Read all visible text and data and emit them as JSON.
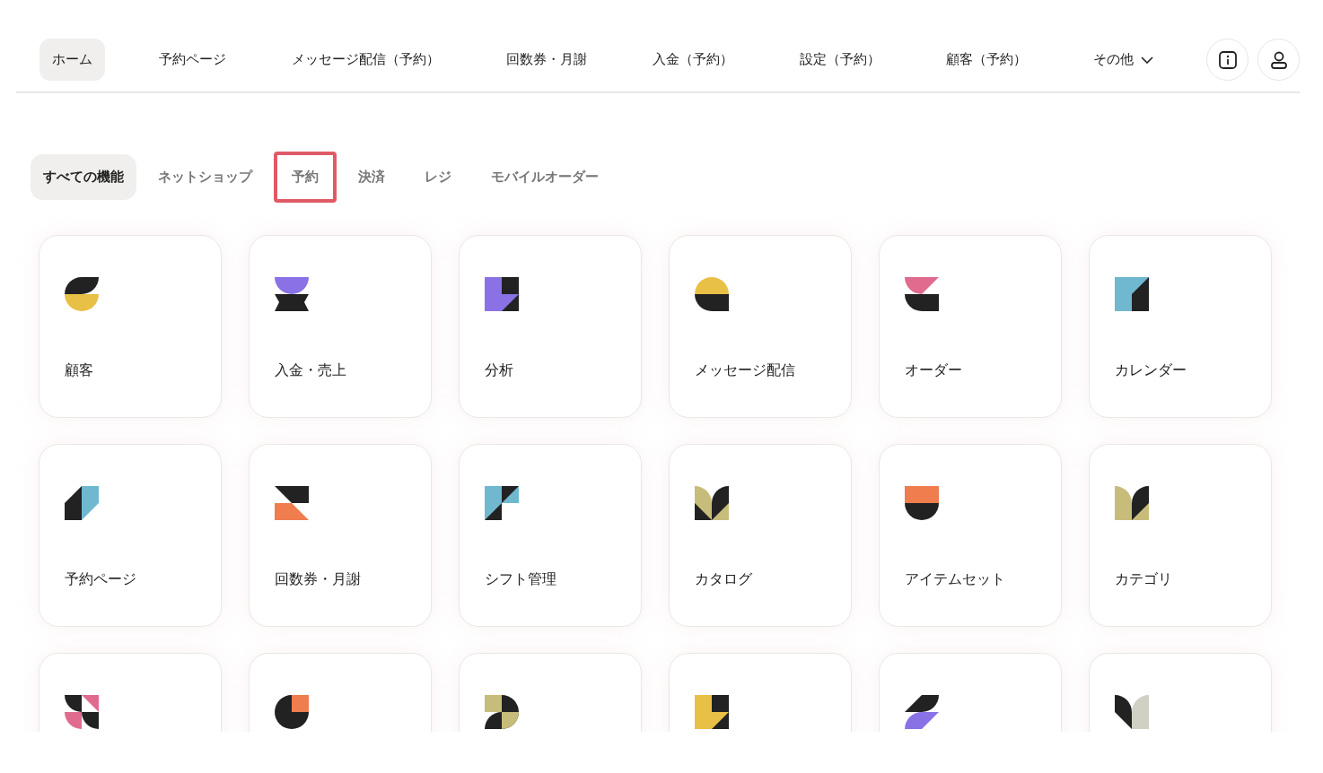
{
  "nav": {
    "items": [
      {
        "label": "ホーム",
        "selected": true
      },
      {
        "label": "予約ページ",
        "selected": false
      },
      {
        "label": "メッセージ配信（予約）",
        "selected": false
      },
      {
        "label": "回数券・月謝",
        "selected": false
      },
      {
        "label": "入金（予約）",
        "selected": false
      },
      {
        "label": "設定（予約）",
        "selected": false
      },
      {
        "label": "顧客（予約）",
        "selected": false
      },
      {
        "label": "その他",
        "selected": false,
        "kind": "dropdown"
      }
    ]
  },
  "filter_tabs": [
    {
      "label": "すべての機能",
      "selected": true,
      "highlighted": false
    },
    {
      "label": "ネットショップ",
      "selected": false,
      "highlighted": false
    },
    {
      "label": "予約",
      "selected": false,
      "highlighted": true
    },
    {
      "label": "決済",
      "selected": false,
      "highlighted": false
    },
    {
      "label": "レジ",
      "selected": false,
      "highlighted": false
    },
    {
      "label": "モバイルオーダー",
      "selected": false,
      "highlighted": false
    }
  ],
  "features": [
    {
      "kind": "full",
      "label": "顧客"
    },
    {
      "kind": "full",
      "label": "入金・売上"
    },
    {
      "kind": "full",
      "label": "分析"
    },
    {
      "kind": "full",
      "label": "メッセージ配信"
    },
    {
      "kind": "full",
      "label": "オーダー"
    },
    {
      "kind": "full",
      "label": "カレンダー"
    },
    {
      "kind": "full",
      "label": "予約ページ"
    },
    {
      "kind": "full",
      "label": "回数券・月謝"
    },
    {
      "kind": "full",
      "label": "シフト管理"
    },
    {
      "kind": "full",
      "label": "カタログ"
    },
    {
      "kind": "full",
      "label": "アイテムセット"
    },
    {
      "kind": "full",
      "label": "カテゴリ"
    },
    {
      "kind": "cut-off"
    },
    {
      "kind": "cut-off"
    },
    {
      "kind": "cut-off"
    },
    {
      "kind": "cut-off"
    },
    {
      "kind": "cut-off"
    },
    {
      "kind": "cut-off"
    }
  ]
}
